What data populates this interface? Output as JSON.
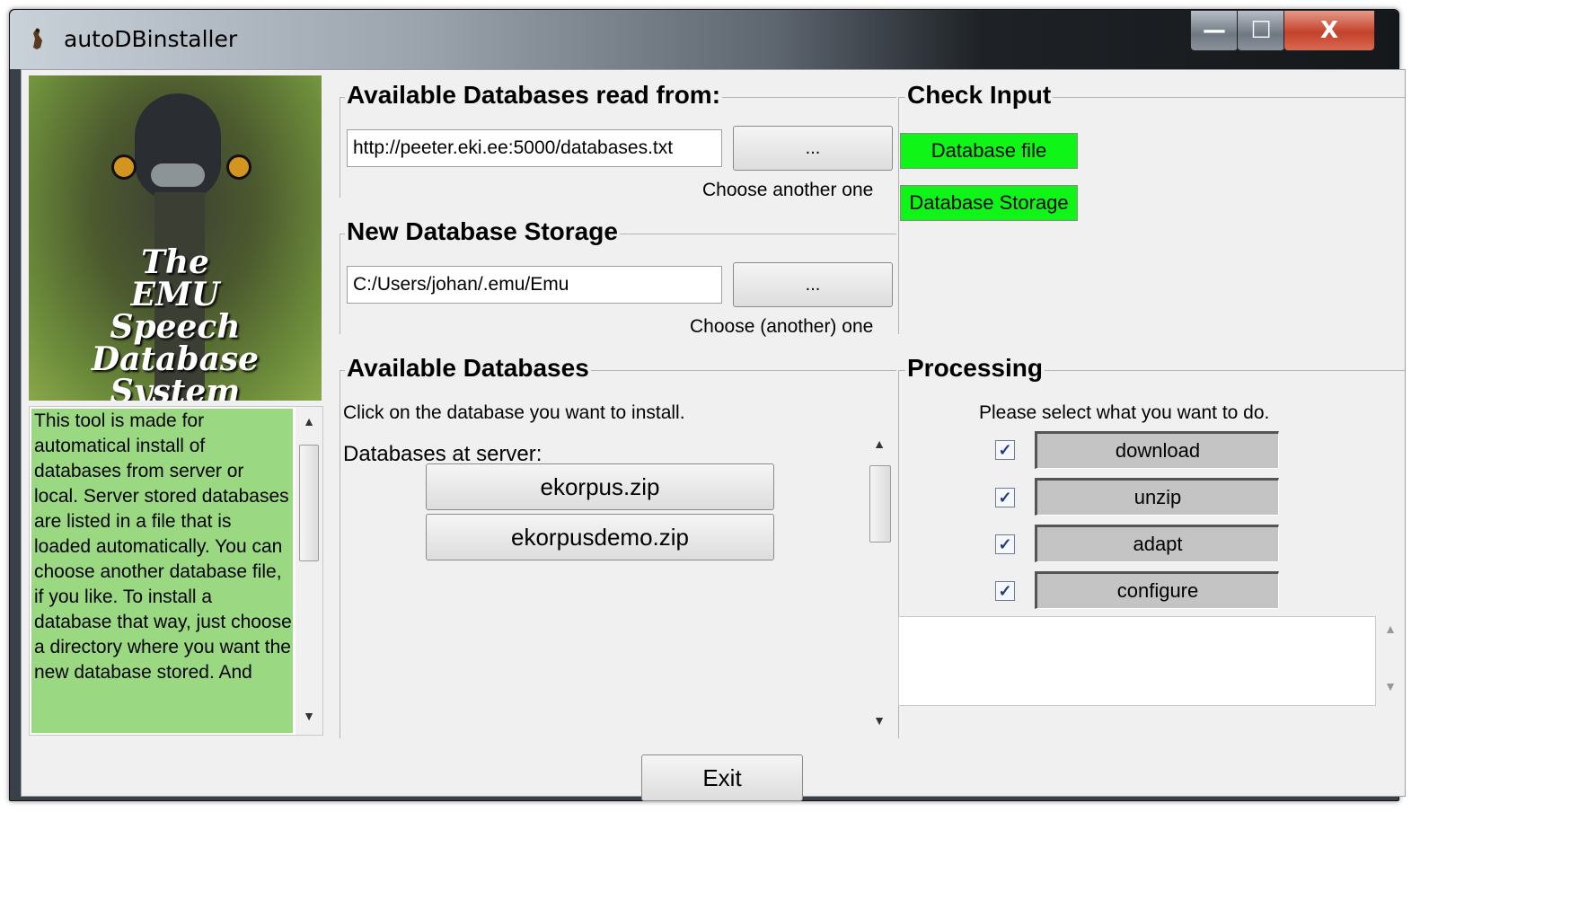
{
  "window": {
    "title": "autoDBinstaller",
    "minimize_glyph": "—",
    "maximize_glyph": "☐",
    "close_glyph": "X"
  },
  "logo": {
    "caption_line1": "The",
    "caption_line2": "EMU",
    "caption_line3": "Speech Database",
    "caption_line4": "System"
  },
  "help": {
    "text": "This tool is made for automatical install of databases from server or local.  Server stored databases are listed in a file that is loaded automatically.  You can choose another database file, if you like.  To install a database that way, just choose a directory where you want the new database stored. And"
  },
  "source": {
    "legend": "Available Databases read from:",
    "url": "http://peeter.eki.ee:5000/databases.txt",
    "browse_label": "...",
    "hint": "Choose another one"
  },
  "storage": {
    "legend": "New Database Storage",
    "path": "C:/Users/johan/.emu/Emu",
    "browse_label": "...",
    "hint": "Choose (another) one"
  },
  "check_input": {
    "legend": "Check Input",
    "database_file": "Database file",
    "database_storage": "Database Storage",
    "ok_color": "#0ff517"
  },
  "available": {
    "legend": "Available Databases",
    "instruction": "Click on the database you want to install.",
    "list_header": "Databases at server:",
    "items": [
      "ekorpus.zip",
      "ekorpusdemo.zip"
    ]
  },
  "processing": {
    "legend": "Processing",
    "instruction": "Please select what you want to do.",
    "tasks": [
      {
        "label": "download",
        "checked": true
      },
      {
        "label": "unzip",
        "checked": true
      },
      {
        "label": "adapt",
        "checked": true
      },
      {
        "label": "configure",
        "checked": true
      }
    ],
    "check_glyph": "✓"
  },
  "footer": {
    "exit_label": "Exit"
  }
}
